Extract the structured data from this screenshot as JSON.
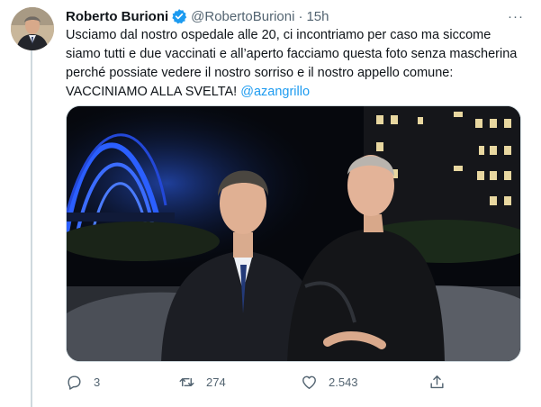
{
  "tweet": {
    "author_name": "Roberto Burioni",
    "handle": "@RobertoBurioni",
    "separator": "·",
    "time": "15h",
    "text": "Usciamo dal nostro ospedale alle 20, ci incontriamo per caso ma siccome siamo tutti e due vaccinati e all’aperto facciamo questa foto senza mascherina perché possiate vedere il nostro sorriso e il nostro appello comune: VACCINIAMO ALLA SVELTA! ",
    "mention": "@azangrillo",
    "more_label": "···"
  },
  "stats": {
    "replies": "3",
    "retweets": "274",
    "likes": "2.543"
  },
  "icons": {
    "verified": "verified-badge-icon",
    "more": "more-options-icon",
    "reply": "reply-icon",
    "retweet": "retweet-icon",
    "like": "heart-icon",
    "share": "share-icon"
  },
  "colors": {
    "accent": "#1d9bf0",
    "text": "#0f1419",
    "secondary": "#536471",
    "border": "#cfd9de"
  }
}
